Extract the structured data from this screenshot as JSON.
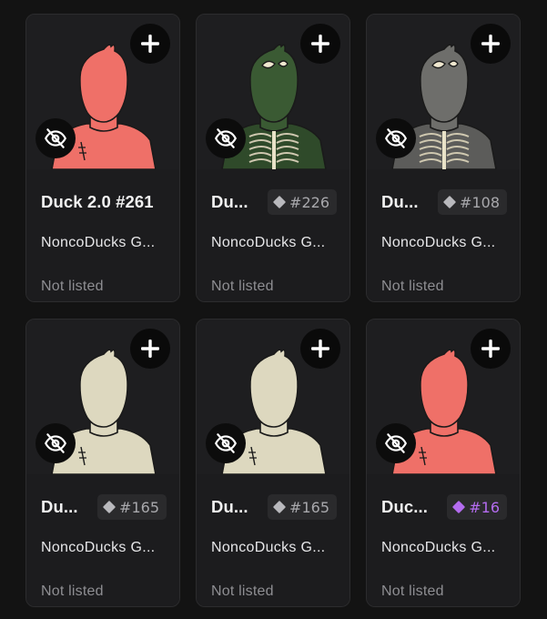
{
  "cards": [
    {
      "title": "Duck 2.0 #261",
      "rank": "",
      "collection": "NoncoDucks G...",
      "status": "Not listed",
      "body_color": "#ef7068",
      "skin_color": "#ef7068",
      "variant": "plain",
      "gem_color": ""
    },
    {
      "title": "Du...",
      "rank": "#226",
      "collection": "NoncoDucks G...",
      "status": "Not listed",
      "body_color": "#2f4a2a",
      "skin_color": "#3a5a33",
      "variant": "skeleton",
      "gem_color": "#b9b9bd"
    },
    {
      "title": "Du...",
      "rank": "#108",
      "collection": "NoncoDucks G...",
      "status": "Not listed",
      "body_color": "#5c5c5a",
      "skin_color": "#6e6e6b",
      "variant": "skeleton",
      "gem_color": "#b9b9bd"
    },
    {
      "title": "Du...",
      "rank": "#165",
      "collection": "NoncoDucks G...",
      "status": "Not listed",
      "body_color": "#ddd8bf",
      "skin_color": "#ddd8bf",
      "variant": "plain",
      "gem_color": "#b9b9bd"
    },
    {
      "title": "Du...",
      "rank": "#165",
      "collection": "NoncoDucks G...",
      "status": "Not listed",
      "body_color": "#ddd8bf",
      "skin_color": "#ddd8bf",
      "variant": "plain",
      "gem_color": "#b9b9bd"
    },
    {
      "title": "Duc...",
      "rank": "#16",
      "collection": "NoncoDucks G...",
      "status": "Not listed",
      "body_color": "#ef7068",
      "skin_color": "#ef7068",
      "variant": "plain",
      "gem_color": "#b46cf0"
    }
  ],
  "icons": {
    "add": "plus-icon",
    "hide": "eye-off-icon",
    "rank": "diamond-icon"
  }
}
